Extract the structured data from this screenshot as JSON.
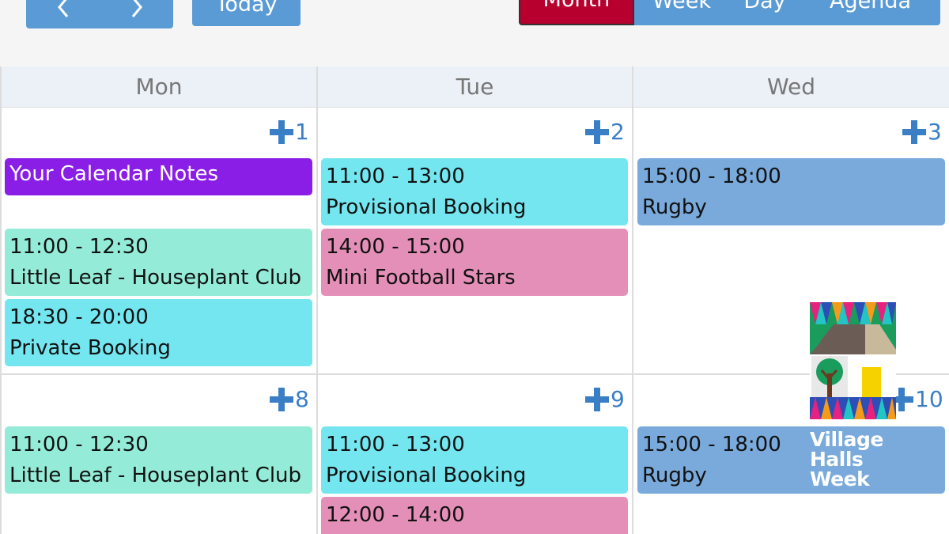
{
  "toolbar": {
    "prev_label": "‹",
    "next_label": "›",
    "today_label": "Today",
    "views": [
      "Month",
      "Week",
      "Day",
      "Agenda"
    ],
    "active_view": "Month"
  },
  "colors": {
    "primary": "#5b9bd5",
    "active_view": "#b8002e",
    "notes": "#8a1ee6",
    "cyan_event": "#74e6f0",
    "mint_event": "#94ecd8",
    "pink_event": "#e48fb8",
    "blue_event": "#79aadb"
  },
  "headers": [
    "Mon",
    "Tue",
    "Wed"
  ],
  "weeks": [
    {
      "days": [
        {
          "date": "1",
          "events": [
            {
              "type": "notes",
              "title": "Your Calendar Notes"
            },
            {
              "time": "11:00 - 12:30",
              "title": "Little Leaf - Houseplant Club"
            },
            {
              "time": "18:30 - 20:00",
              "title": "Private Booking"
            }
          ]
        },
        {
          "date": "2",
          "events": [
            {
              "time": "11:00 - 13:00",
              "title": "Provisional Booking"
            },
            {
              "time": "14:00 - 15:00",
              "title": "Mini Football Stars"
            }
          ]
        },
        {
          "date": "3",
          "events": [
            {
              "time": "15:00 - 18:00",
              "title": "Rugby"
            }
          ]
        }
      ]
    },
    {
      "days": [
        {
          "date": "8",
          "events": [
            {
              "time": "11:00 - 12:30",
              "title": "Little Leaf - Houseplant Club"
            }
          ]
        },
        {
          "date": "9",
          "events": [
            {
              "time": "11:00 - 13:00",
              "title": "Provisional Booking"
            },
            {
              "time": "12:00 - 14:00",
              "title": ""
            }
          ]
        },
        {
          "date": "10",
          "events": [
            {
              "time": "15:00 - 18:00",
              "title": "Rugby"
            }
          ]
        }
      ]
    }
  ],
  "logo": {
    "lines": [
      "Village",
      "Halls",
      "Week"
    ]
  }
}
